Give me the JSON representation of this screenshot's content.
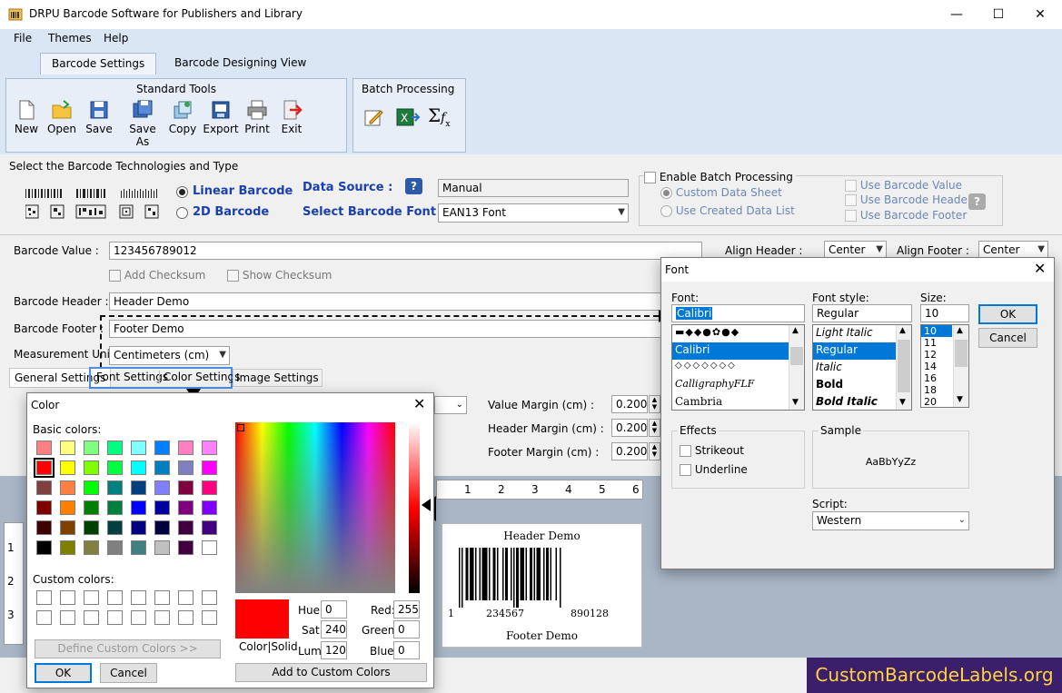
{
  "window": {
    "title": "DRPU Barcode Software for Publishers and Library",
    "minimize": "—",
    "maximize": "☐",
    "close": "✕"
  },
  "menu": {
    "file": "File",
    "themes": "Themes",
    "help": "Help"
  },
  "tabs": {
    "settings": "Barcode Settings",
    "designing": "Barcode Designing View"
  },
  "standard_tools": {
    "title": "Standard Tools",
    "items": [
      "New",
      "Open",
      "Save",
      "Save As",
      "Copy",
      "Export",
      "Print",
      "Exit"
    ]
  },
  "batch": {
    "title": "Batch Processing"
  },
  "tech": {
    "heading": "Select the Barcode Technologies and Type",
    "linear": "Linear Barcode",
    "twod": "2D Barcode"
  },
  "data_source": {
    "label": "Data Source :",
    "value": "Manual"
  },
  "barcode_font": {
    "label": "Select Barcode Font :",
    "value": "EAN13 Font"
  },
  "batch_opts": {
    "enable": "Enable Batch Processing",
    "custom_sheet": "Custom Data Sheet",
    "created_list": "Use Created Data List",
    "use_value": "Use Barcode Value",
    "use_header": "Use Barcode Header",
    "use_footer": "Use Barcode Footer"
  },
  "form": {
    "value_label": "Barcode Value :",
    "value": "123456789012",
    "add_checksum": "Add Checksum",
    "show_checksum": "Show Checksum",
    "header_label": "Barcode Header :",
    "header": "Header Demo",
    "footer_label": "Barcode Footer :",
    "footer": "Footer Demo",
    "unit_label": "Measurement Unit :",
    "unit": "Centimeters (cm)",
    "align_header_label": "Align Header :",
    "align_header": "Center",
    "align_footer_label": "Align Footer :",
    "align_footer": "Center"
  },
  "sub_tabs": {
    "general": "General Settings",
    "font": "Font Settings",
    "color": "Color Settings",
    "image": "Image Settings"
  },
  "margins": {
    "value_label": "Value Margin (cm) :",
    "value": "0.200",
    "header_label": "Header Margin (cm) :",
    "header": "0.200",
    "footer_label": "Footer Margin (cm) :",
    "footer": "0.200"
  },
  "ruler": {
    "ticks": [
      "1",
      "2",
      "3",
      "4",
      "5",
      "6"
    ],
    "vticks": [
      "1",
      "2",
      "3"
    ]
  },
  "preview": {
    "header": "Header Demo",
    "footer": "Footer Demo",
    "lead": "1",
    "left": "234567",
    "right": "890128"
  },
  "color_dialog": {
    "title": "Color",
    "basic": "Basic colors:",
    "custom": "Custom colors:",
    "define": "Define Custom Colors >>",
    "ok": "OK",
    "cancel": "Cancel",
    "color_solid": "Color|Solid",
    "hue_label": "Hue:",
    "hue": "0",
    "sat_label": "Sat:",
    "sat": "240",
    "lum_label": "Lum:",
    "lum": "120",
    "red_label": "Red:",
    "red": "255",
    "green_label": "Green:",
    "green": "0",
    "blue_label": "Blue:",
    "blue": "0",
    "add": "Add to Custom Colors",
    "selected_color": "#ff0000",
    "basic_colors": [
      "#ff8080",
      "#ffff80",
      "#80ff80",
      "#00ff80",
      "#80ffff",
      "#0080ff",
      "#ff80c0",
      "#ff80ff",
      "#ff0000",
      "#ffff00",
      "#80ff00",
      "#00ff40",
      "#00ffff",
      "#0080c0",
      "#8080c0",
      "#ff00ff",
      "#804040",
      "#ff8040",
      "#00ff00",
      "#008080",
      "#004080",
      "#8080ff",
      "#800040",
      "#ff0080",
      "#800000",
      "#ff8000",
      "#008000",
      "#008040",
      "#0000ff",
      "#0000a0",
      "#800080",
      "#8000ff",
      "#400000",
      "#804000",
      "#004000",
      "#004040",
      "#000080",
      "#000040",
      "#400040",
      "#400080",
      "#000000",
      "#808000",
      "#808040",
      "#808080",
      "#408080",
      "#c0c0c0",
      "#400040",
      "#ffffff"
    ]
  },
  "font_dialog": {
    "title": "Font",
    "font_label": "Font:",
    "font_value": "Calibri",
    "fonts": [
      "▬◆◆●✿●◆",
      "Calibri",
      "◇◇◇◇◇◇◇",
      "CalligraphyFLF",
      "Cambria"
    ],
    "style_label": "Font style:",
    "style_value": "Regular",
    "styles": [
      "Light Italic",
      "Regular",
      "Italic",
      "Bold",
      "Bold Italic"
    ],
    "size_label": "Size:",
    "size_value": "10",
    "sizes": [
      "10",
      "11",
      "12",
      "14",
      "16",
      "18",
      "20"
    ],
    "ok": "OK",
    "cancel": "Cancel",
    "effects": "Effects",
    "strikeout": "Strikeout",
    "underline": "Underline",
    "sample": "Sample",
    "sample_text": "AaBbYyZz",
    "script_label": "Script:",
    "script": "Western"
  },
  "watermark": "CustomBarcodeLabels.org"
}
